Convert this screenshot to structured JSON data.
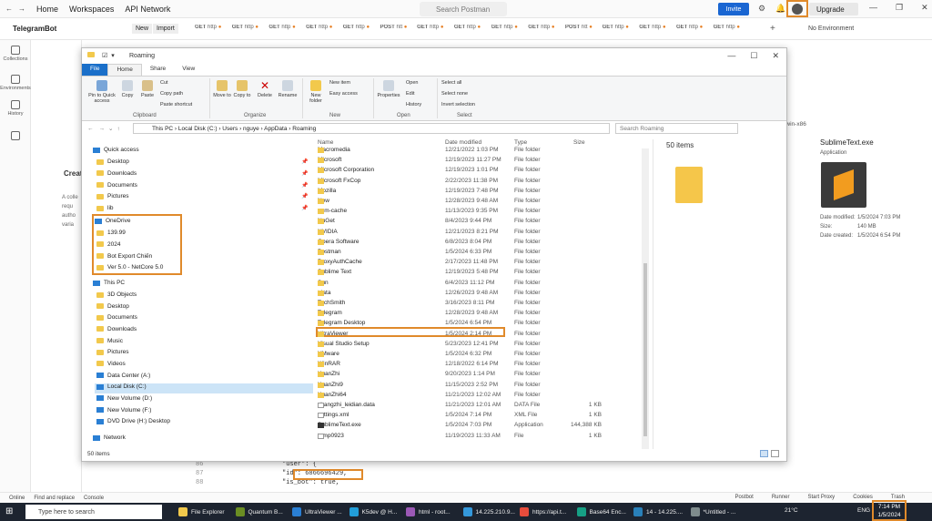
{
  "postman": {
    "menu": [
      "Home",
      "Workspaces",
      "API Network"
    ],
    "search_placeholder": "Search Postman",
    "invite_label": "Invite",
    "upgrade_label": "Upgrade",
    "workspace_name": "TelegramBot",
    "new_label": "New",
    "import_label": "Import",
    "tabs": [
      {
        "method": "GET",
        "name": "http"
      },
      {
        "method": "GET",
        "name": "http"
      },
      {
        "method": "GET",
        "name": "http"
      },
      {
        "method": "GET",
        "name": "http"
      },
      {
        "method": "GET",
        "name": "http"
      },
      {
        "method": "POST",
        "name": "htt"
      },
      {
        "method": "GET",
        "name": "http"
      },
      {
        "method": "GET",
        "name": "http"
      },
      {
        "method": "GET",
        "name": "http"
      },
      {
        "method": "GET",
        "name": "http"
      },
      {
        "method": "POST",
        "name": "htt"
      },
      {
        "method": "GET",
        "name": "http"
      },
      {
        "method": "GET",
        "name": "http"
      },
      {
        "method": "GET",
        "name": "http"
      },
      {
        "method": "GET",
        "name": "http"
      }
    ],
    "env_label": "No Environment",
    "sidebar": [
      "Collections",
      "Environments",
      "History"
    ],
    "create_text": "Creat",
    "collection_desc": "A colle requ autho varia",
    "search_win_text": "h win-x86",
    "code_lines": [
      {
        "ln": "86",
        "text": "\"user\": {"
      },
      {
        "ln": "87",
        "text": "  \"id\": 6866696429,"
      },
      {
        "ln": "88",
        "text": "  \"is_bot\": true,"
      }
    ],
    "bottom_left": [
      "Online",
      "Find and replace",
      "Console"
    ],
    "bottom_right": [
      "Postbot",
      "Runner",
      "Start Proxy",
      "Cookies",
      "Trash"
    ]
  },
  "explorer": {
    "title": "Roaming",
    "ribbon_tabs": [
      "File",
      "Home",
      "Share",
      "View"
    ],
    "ribbon": {
      "pin": "Pin to Quick access",
      "copy": "Copy",
      "paste": "Paste",
      "cut": "Cut",
      "copy_path": "Copy path",
      "paste_shortcut": "Paste shortcut",
      "clipboard": "Clipboard",
      "move_to": "Move to",
      "copy_to": "Copy to",
      "delete": "Delete",
      "rename": "Rename",
      "organize": "Organize",
      "new_folder": "New folder",
      "new_item": "New item",
      "easy_access": "Easy access",
      "new_group": "New",
      "properties": "Properties",
      "open": "Open",
      "edit": "Edit",
      "history": "History",
      "open_group": "Open",
      "select_all": "Select all",
      "select_none": "Select none",
      "invert": "Invert selection",
      "select_group": "Select"
    },
    "path": "This PC  ›  Local Disk (C:)  ›  Users  ›  nguye  ›  AppData  ›  Roaming",
    "search_placeholder": "Search Roaming",
    "nav": {
      "quick_access": "Quick access",
      "quick": [
        "Desktop",
        "Downloads",
        "Documents",
        "Pictures",
        "lib"
      ],
      "onedrive": "OneDrive",
      "onedrive_items": [
        "139.99",
        "2024",
        "Bot Export Chiến",
        "Ver 5.0 - NetCore 5.0"
      ],
      "this_pc": "This PC",
      "pc_items": [
        "3D Objects",
        "Desktop",
        "Documents",
        "Downloads",
        "Music",
        "Pictures",
        "Videos",
        "Data Center (A:)",
        "Local Disk (C:)",
        "New Volume (D:)",
        "New Volume (F:)",
        "DVD Drive (H:) Desktop"
      ],
      "network": "Network"
    },
    "columns": [
      "Name",
      "Date modified",
      "Type",
      "Size"
    ],
    "files": [
      {
        "name": "Macromedia",
        "date": "12/21/2022 1:03 PM",
        "type": "File folder",
        "size": "",
        "kind": "folder"
      },
      {
        "name": "Microsoft",
        "date": "12/19/2023 11:27 PM",
        "type": "File folder",
        "size": "",
        "kind": "folder"
      },
      {
        "name": "Microsoft Corporation",
        "date": "12/19/2023 1:01 PM",
        "type": "File folder",
        "size": "",
        "kind": "folder"
      },
      {
        "name": "Microsoft FxCop",
        "date": "2/22/2023 11:38 PM",
        "type": "File folder",
        "size": "",
        "kind": "folder"
      },
      {
        "name": "Mozilla",
        "date": "12/19/2023 7:48 PM",
        "type": "File folder",
        "size": "",
        "kind": "folder"
      },
      {
        "name": "New",
        "date": "12/28/2023 9:48 AM",
        "type": "File folder",
        "size": "",
        "kind": "folder"
      },
      {
        "name": "npm-cache",
        "date": "11/13/2023 9:35 PM",
        "type": "File folder",
        "size": "",
        "kind": "folder"
      },
      {
        "name": "NuGet",
        "date": "8/4/2023 9:44 PM",
        "type": "File folder",
        "size": "",
        "kind": "folder"
      },
      {
        "name": "NVIDIA",
        "date": "12/21/2023 8:21 PM",
        "type": "File folder",
        "size": "",
        "kind": "folder"
      },
      {
        "name": "Opera Software",
        "date": "6/8/2023 8:04 PM",
        "type": "File folder",
        "size": "",
        "kind": "folder"
      },
      {
        "name": "Postman",
        "date": "1/5/2024 6:33 PM",
        "type": "File folder",
        "size": "",
        "kind": "folder"
      },
      {
        "name": "ProxyAuthCache",
        "date": "2/17/2023 11:48 PM",
        "type": "File folder",
        "size": "",
        "kind": "folder"
      },
      {
        "name": "Sublime Text",
        "date": "12/19/2023 5:48 PM",
        "type": "File folder",
        "size": "",
        "kind": "folder"
      },
      {
        "name": "Sun",
        "date": "6/4/2023 11:12 PM",
        "type": "File folder",
        "size": "",
        "kind": "folder"
      },
      {
        "name": "tdata",
        "date": "12/26/2023 9:48 AM",
        "type": "File folder",
        "size": "",
        "kind": "folder"
      },
      {
        "name": "TechSmith",
        "date": "3/16/2023 8:11 PM",
        "type": "File folder",
        "size": "",
        "kind": "folder"
      },
      {
        "name": "Telegram",
        "date": "12/28/2023 9:48 AM",
        "type": "File folder",
        "size": "",
        "kind": "folder"
      },
      {
        "name": "Telegram Desktop",
        "date": "1/5/2024 6:54 PM",
        "type": "File folder",
        "size": "",
        "kind": "folder"
      },
      {
        "name": "UltraViewer",
        "date": "1/5/2024 2:14 PM",
        "type": "File folder",
        "size": "",
        "kind": "folder"
      },
      {
        "name": "Visual Studio Setup",
        "date": "5/23/2023 12:41 PM",
        "type": "File folder",
        "size": "",
        "kind": "folder"
      },
      {
        "name": "VMware",
        "date": "1/5/2024 6:32 PM",
        "type": "File folder",
        "size": "",
        "kind": "folder"
      },
      {
        "name": "WinRAR",
        "date": "12/18/2022 6:14 PM",
        "type": "File folder",
        "size": "",
        "kind": "folder"
      },
      {
        "name": "XuanZhi",
        "date": "9/20/2023 1:14 PM",
        "type": "File folder",
        "size": "",
        "kind": "folder"
      },
      {
        "name": "XuanZhi9",
        "date": "11/15/2023 2:52 PM",
        "type": "File folder",
        "size": "",
        "kind": "folder"
      },
      {
        "name": "XuanZhi64",
        "date": "11/21/2023 12:02 AM",
        "type": "File folder",
        "size": "",
        "kind": "folder"
      },
      {
        "name": "changzhi_leidian.data",
        "date": "11/21/2023 12:01 AM",
        "type": "DATA File",
        "size": "1 KB",
        "kind": "file"
      },
      {
        "name": "settings.xml",
        "date": "1/5/2024 7:14 PM",
        "type": "XML File",
        "size": "1 KB",
        "kind": "file"
      },
      {
        "name": "SublimeText.exe",
        "date": "1/5/2024 7:03 PM",
        "type": "Application",
        "size": "144,388 KB",
        "kind": "app"
      },
      {
        "name": "temp0923",
        "date": "11/19/2023 11:33 AM",
        "type": "File",
        "size": "1 KB",
        "kind": "file"
      }
    ],
    "items_count": "50 items",
    "status": "50 items"
  },
  "details": {
    "name": "SublimeText.exe",
    "type": "Application",
    "rows": [
      {
        "label": "Date modified:",
        "value": "1/5/2024 7:03 PM"
      },
      {
        "label": "Size:",
        "value": "140 MB"
      },
      {
        "label": "Date created:",
        "value": "1/5/2024 6:54 PM"
      }
    ]
  },
  "taskbar": {
    "search_placeholder": "Type here to search",
    "apps": [
      "File Explorer",
      "Quantum B...",
      "UltraViewer ...",
      "K5dev @ H...",
      "html - root...",
      "14.225.210.9...",
      "https://api.t...",
      "Base64 Enc...",
      "14 - 14.225....",
      "*Untitled - ..."
    ],
    "weather": "21°C",
    "lang": "ENG",
    "time": "7:14 PM",
    "date": "1/5/2024"
  },
  "colors": {
    "accent": "#e08a2b",
    "file_tab": "#1a6fc9",
    "folder": "#f2c94c",
    "invite": "#1a66d2"
  }
}
